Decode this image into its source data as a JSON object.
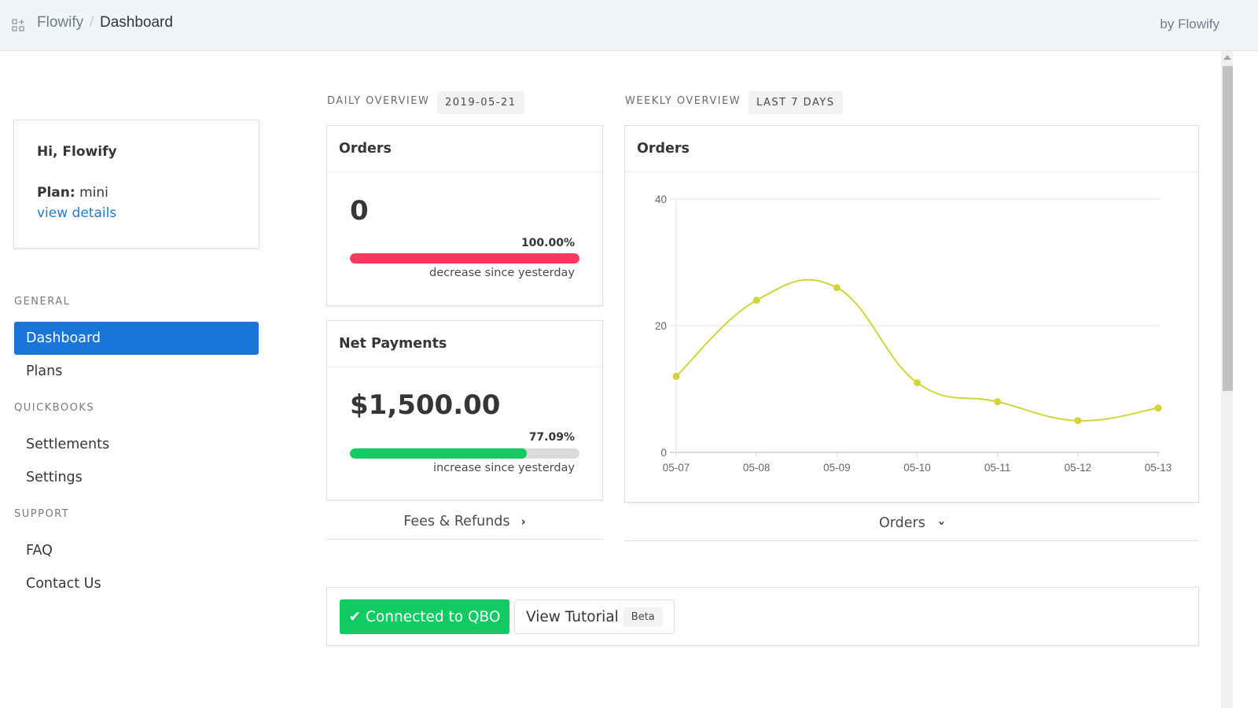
{
  "topbar": {
    "apps_icon": "apps-grid-icon",
    "breadcrumb": {
      "root": "Flowify",
      "separator": "/",
      "current": "Dashboard"
    },
    "byline": "by Flowify"
  },
  "user_card": {
    "greeting": "Hi, Flowify",
    "plan_label": "Plan:",
    "plan_value": "mini",
    "details_link": "view details"
  },
  "sidebar": {
    "sections": [
      {
        "label": "GENERAL",
        "items": [
          {
            "label": "Dashboard",
            "active": true
          },
          {
            "label": "Plans",
            "active": false
          }
        ]
      },
      {
        "label": "QUICKBOOKS",
        "items": [
          {
            "label": "Settlements",
            "active": false
          },
          {
            "label": "Settings",
            "active": false
          }
        ]
      },
      {
        "label": "SUPPORT",
        "items": [
          {
            "label": "FAQ",
            "active": false
          },
          {
            "label": "Contact Us",
            "active": false
          }
        ]
      }
    ]
  },
  "daily": {
    "label": "DAILY OVERVIEW",
    "date_tag": "2019-05-21",
    "orders": {
      "title": "Orders",
      "value": "0",
      "percent_label": "100.00%",
      "percent": 100,
      "caption": "decrease since yesterday",
      "color": "#ff3860"
    },
    "net_payments": {
      "title": "Net Payments",
      "value": "$1,500.00",
      "percent_label": "77.09%",
      "percent": 77.09,
      "caption": "increase since yesterday",
      "color": "#0fcb62"
    },
    "fees_link": "Fees & Refunds",
    "fees_icon": "chevron-right-icon"
  },
  "weekly": {
    "label": "WEEKLY OVERVIEW",
    "range_tag": "LAST 7 DAYS",
    "card_title": "Orders",
    "metric_select": "Orders",
    "metric_icon": "chevron-down-icon"
  },
  "chart_data": {
    "type": "line",
    "title": "Orders",
    "xlabel": "",
    "ylabel": "",
    "categories": [
      "05-07",
      "05-08",
      "05-09",
      "05-10",
      "05-11",
      "05-12",
      "05-13"
    ],
    "series": [
      {
        "name": "Orders",
        "values": [
          12,
          24,
          26,
          11,
          8,
          5,
          7
        ],
        "color": "#d4d43a"
      }
    ],
    "ylim": [
      0,
      40
    ],
    "yticks": [
      0,
      20,
      40
    ],
    "grid": true,
    "legend": "none",
    "smooth": true
  },
  "actions": {
    "connected_label": "Connected to QBO",
    "connected_icon": "checkmark-icon",
    "tutorial_label": "View Tutorial",
    "tutorial_badge": "Beta"
  }
}
